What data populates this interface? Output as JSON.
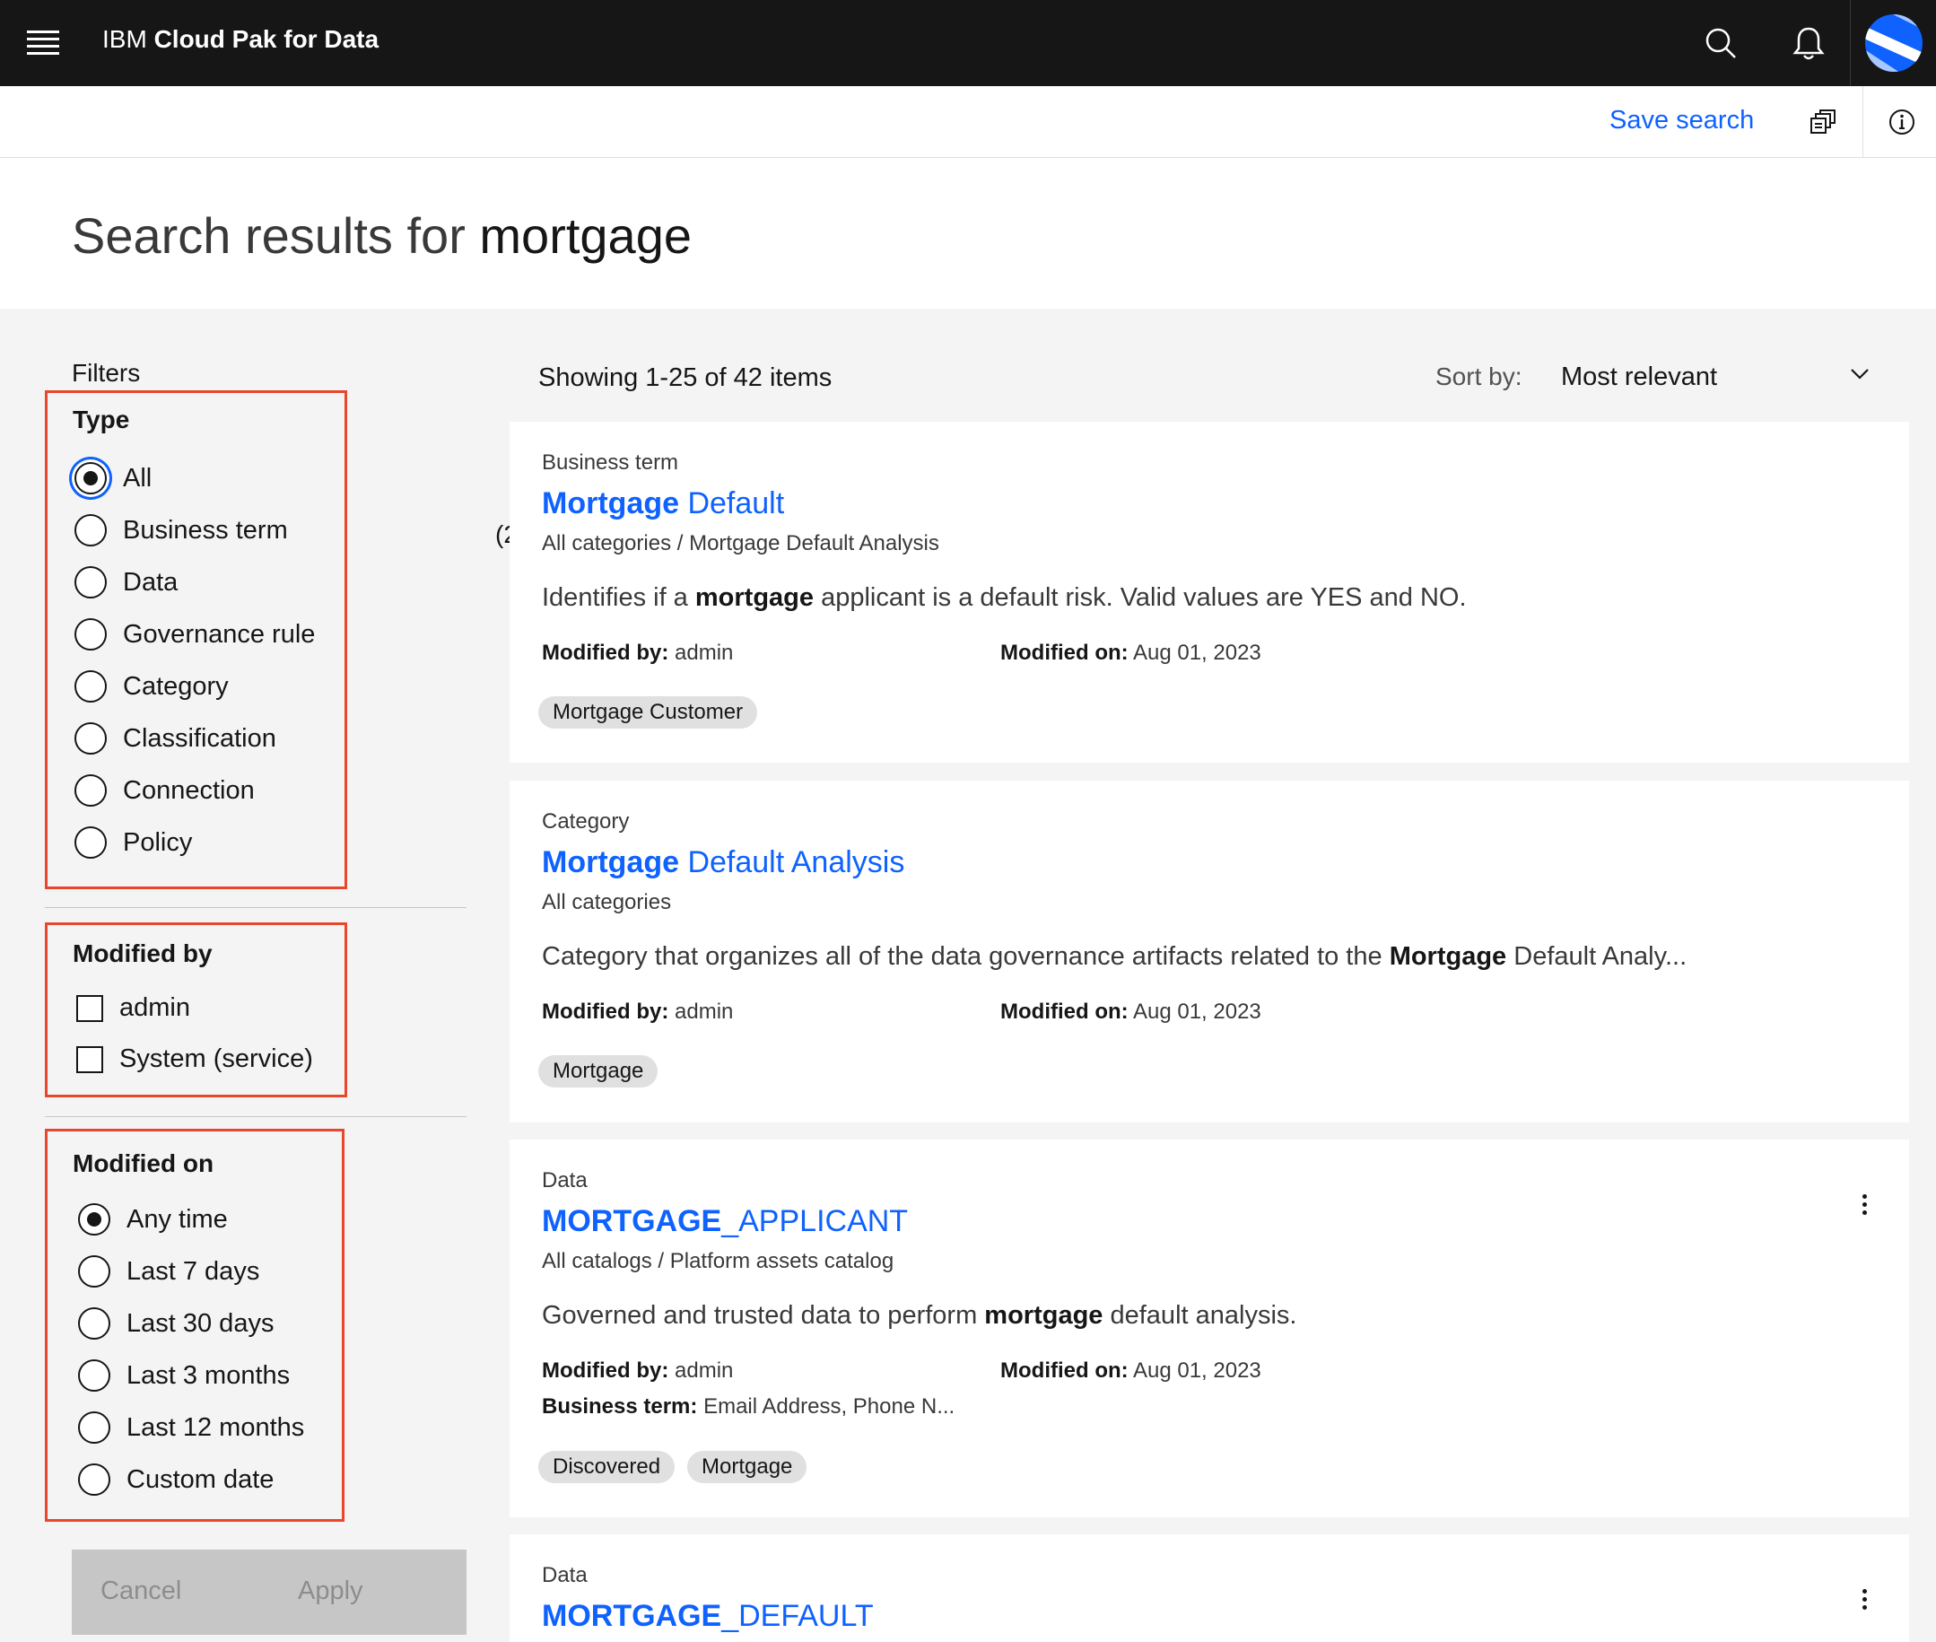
{
  "header": {
    "brand_prefix": "IBM",
    "brand_name": "Cloud Pak for Data"
  },
  "actionbar": {
    "save_search": "Save search"
  },
  "page": {
    "title_prefix": "Search results for",
    "search_term": "mortgage"
  },
  "filters": {
    "label": "Filters",
    "type": {
      "title": "Type",
      "options": [
        "All",
        "Business term",
        "Data",
        "Governance rule",
        "Category",
        "Classification",
        "Connection",
        "Policy"
      ],
      "selected": "All"
    },
    "modified_by": {
      "title": "Modified by",
      "options": [
        "admin",
        "System (service)"
      ]
    },
    "modified_on": {
      "title": "Modified on",
      "options": [
        "Any time",
        "Last 7 days",
        "Last 30 days",
        "Last 3 months",
        "Last 12 months",
        "Custom date"
      ],
      "selected": "Any time"
    },
    "cancel_label": "Cancel",
    "apply_label": "Apply"
  },
  "results": {
    "showing": "Showing 1-25 of 42 items",
    "sort_label": "Sort by:",
    "sort_value": "Most relevant",
    "clipped_text": "(2",
    "modified_by_label": "Modified by:",
    "modified_on_label": "Modified on:",
    "business_term_label": "Business term:",
    "items": [
      {
        "type": "Business term",
        "title_hl": "Mortgage",
        "title_rest": " Default",
        "path": "All categories / Mortgage Default Analysis",
        "desc_pre": "Identifies if a ",
        "desc_hl": "mortgage",
        "desc_post": " applicant is a default risk. Valid values are YES and NO.",
        "modified_by": "admin",
        "modified_on": "Aug 01, 2023",
        "tags": [
          "Mortgage Customer"
        ]
      },
      {
        "type": "Category",
        "title_hl": "Mortgage",
        "title_rest": " Default Analysis",
        "path": "All categories",
        "desc_pre": "Category that organizes all of the data governance artifacts related to the ",
        "desc_hl": "Mortgage",
        "desc_post": " Default Analy...",
        "modified_by": "admin",
        "modified_on": "Aug 01, 2023",
        "tags": [
          "Mortgage"
        ]
      },
      {
        "type": "Data",
        "title_hl": "MORTGAGE",
        "title_rest": "_APPLICANT",
        "path": "All catalogs / Platform assets catalog",
        "desc_pre": "Governed and trusted data to perform ",
        "desc_hl": "mortgage",
        "desc_post": " default analysis.",
        "modified_by": "admin",
        "modified_on": "Aug 01, 2023",
        "business_term": "Email Address, Phone N...",
        "tags": [
          "Discovered",
          "Mortgage"
        ]
      },
      {
        "type": "Data",
        "title_hl": "MORTGAGE",
        "title_rest": "_DEFAULT"
      }
    ]
  },
  "colors": {
    "link": "#0f62fe",
    "highlight_border": "#e8472c",
    "topbar": "#161616"
  }
}
